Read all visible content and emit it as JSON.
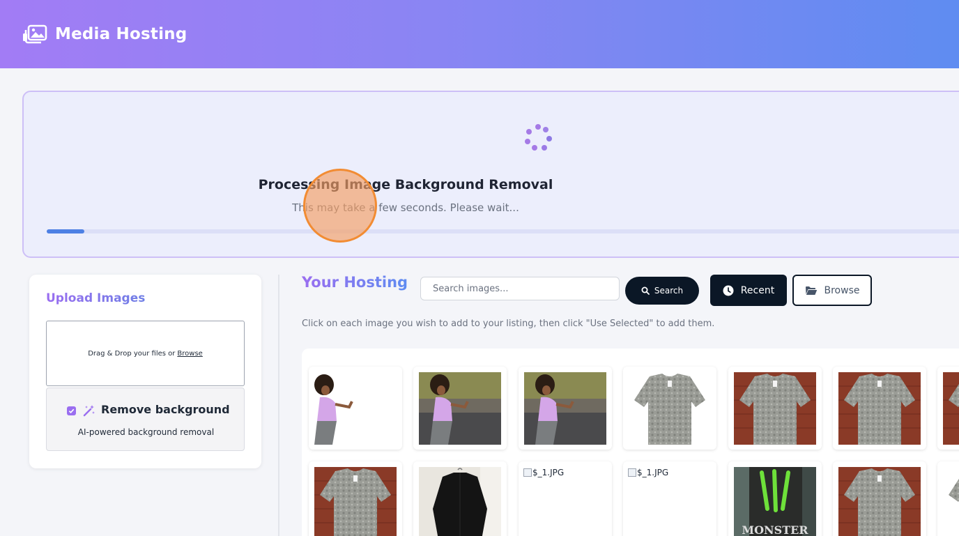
{
  "header": {
    "title": "Media Hosting",
    "logo_icon": "images-icon",
    "gradient_colors": [
      "#a27cf5",
      "#5f8cf1"
    ]
  },
  "processing": {
    "title": "Processing Image Background Removal",
    "subtitle": "This may take a few seconds. Please wait...",
    "progress": 0.04,
    "spinner_icon": "spinner-icon"
  },
  "upload": {
    "title": "Upload Images",
    "dropzone_text": "Drag & Drop your files or",
    "browse_link": "Browse",
    "remove_bg": {
      "checked": true,
      "icon": "magic-wand-icon",
      "label": "Remove background",
      "description": "AI-powered background removal"
    }
  },
  "hosting": {
    "title": "Your Hosting",
    "search_placeholder": "Search images...",
    "search_button": "Search",
    "recent_button": "Recent",
    "browse_button": "Browse",
    "hint": "Click on each image you wish to add to your listing, then click \"Use Selected\" to add them."
  },
  "gallery": {
    "row1": [
      {
        "kind": "runner-cutout"
      },
      {
        "kind": "runner-photo"
      },
      {
        "kind": "runner-photo"
      },
      {
        "kind": "shirt-white"
      },
      {
        "kind": "shirt-brick"
      },
      {
        "kind": "shirt-brick"
      },
      {
        "kind": "shirt-brick"
      }
    ],
    "row2": [
      {
        "kind": "shirt-brick"
      },
      {
        "kind": "jacket-black"
      },
      {
        "kind": "broken",
        "alt": "$_1.JPG"
      },
      {
        "kind": "broken",
        "alt": "$_1.JPG"
      },
      {
        "kind": "monster-can",
        "brand_text": "MONSTER"
      },
      {
        "kind": "shirt-brick"
      },
      {
        "kind": "shirt-white"
      }
    ]
  }
}
